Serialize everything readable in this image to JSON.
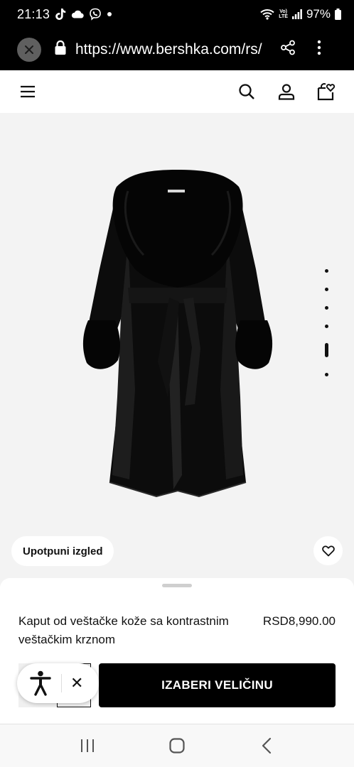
{
  "status_bar": {
    "time": "21:13",
    "battery": "97%",
    "network": "LTE",
    "volte": "Vo)",
    "icons": [
      "tiktok-icon",
      "cloud-icon",
      "viber-icon",
      "dot-icon",
      "wifi-icon",
      "signal-icon",
      "battery-icon"
    ]
  },
  "browser": {
    "url": "https://www.bershka.com/rs/"
  },
  "header": {
    "icons": [
      "menu-icon",
      "search-icon",
      "user-icon",
      "bag-icon"
    ]
  },
  "product": {
    "complete_look_label": "Upotpuni izgled",
    "name": "Kaput od veštačke kože sa kontrastnim veštačkim krznom",
    "price": "RSD8,990.00",
    "select_size_label": "IZABERI VELIČINU",
    "gallery_dots": 6,
    "gallery_active_index": 4
  },
  "colors": {
    "brand_black": "#000000",
    "image_bg": "#f3f3f3",
    "surface": "#ffffff"
  },
  "nav_bar": {
    "icons": [
      "recents-icon",
      "home-icon",
      "back-icon"
    ]
  }
}
